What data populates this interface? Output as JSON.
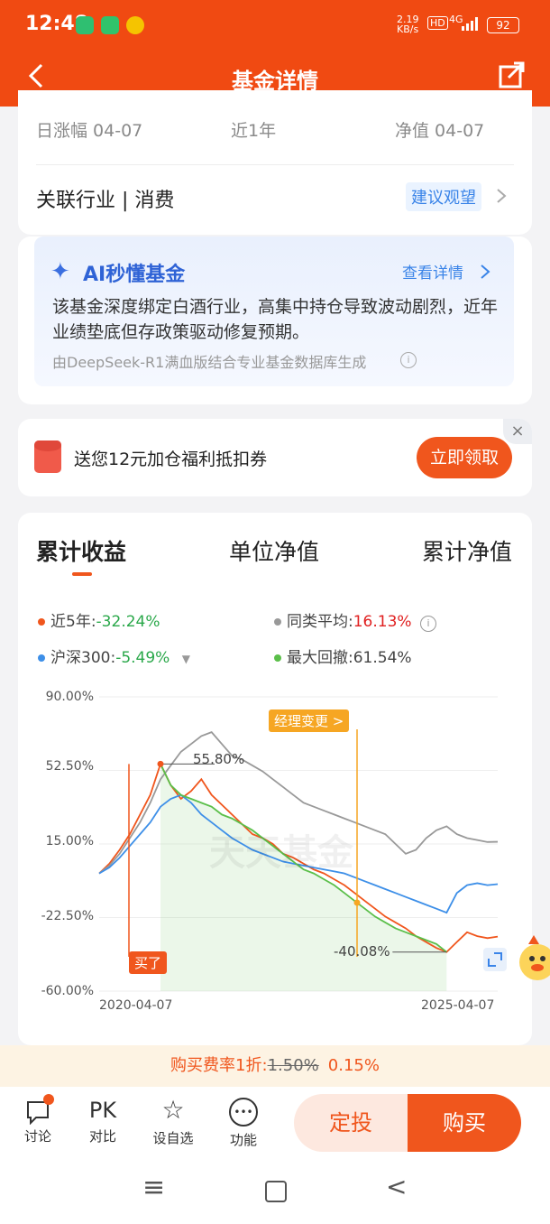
{
  "status": {
    "time": "12:48",
    "speed": "2.19\nKB/s",
    "hd": "HD",
    "network": "4G",
    "battery": "92"
  },
  "header": {
    "title": "基金详情"
  },
  "summary": {
    "labels": [
      "日涨幅 04-07",
      "近1年",
      "净值 04-07"
    ],
    "industry_label": "关联行业 | 消费",
    "advice": "建议观望"
  },
  "ai": {
    "title": "AI秒懂基金",
    "link": "查看详情",
    "text": "该基金深度绑定白酒行业，高集中持仓导致波动剧烈，近年业绩垫底但存政策驱动修复预期。",
    "source": "由DeepSeek-R1满血版结合专业基金数据库生成"
  },
  "coupon": {
    "text": "送您12元加仓福利抵扣券",
    "button": "立即领取",
    "close": "×"
  },
  "chart_tabs": [
    "累计收益",
    "单位净值",
    "累计净值"
  ],
  "legend": {
    "items": [
      {
        "label": "近5年:",
        "value": "-32.24%",
        "color": "#f0561d",
        "value_color": "#2aa84a"
      },
      {
        "label": "同类平均:",
        "value": "16.13%",
        "color": "#999999",
        "value_color": "#e02020"
      },
      {
        "label": "沪深300:",
        "value": "-5.49%",
        "color": "#3d8fe8",
        "value_color": "#2aa84a"
      },
      {
        "label": "最大回撤:",
        "value": "61.54%",
        "color": "#5bbf4a",
        "value_color": "#333333"
      }
    ]
  },
  "chart_data": {
    "type": "line",
    "x_start": "2020-04-07",
    "x_end": "2025-04-07",
    "yticks": [
      "90.00%",
      "52.50%",
      "15.00%",
      "-22.50%",
      "-60.00%"
    ],
    "ylim": [
      -60,
      90
    ],
    "annotations": {
      "peak": "55.80%",
      "trough": "-40.08%",
      "manager_change": "经理变更 >",
      "buy": "买了"
    },
    "watermark": "天天基金",
    "series": [
      {
        "name": "近5年",
        "color": "#f0561d",
        "values": [
          0,
          5,
          12,
          20,
          30,
          40,
          55.8,
          45,
          38,
          42,
          48,
          40,
          35,
          30,
          25,
          20,
          18,
          15,
          10,
          8,
          5,
          2,
          0,
          -3,
          -6,
          -10,
          -14,
          -18,
          -22,
          -25,
          -28,
          -32,
          -35,
          -38,
          -40.08,
          -35,
          -30,
          -32,
          -33,
          -32.24
        ]
      },
      {
        "name": "同类平均",
        "color": "#999999",
        "values": [
          0,
          4,
          10,
          18,
          26,
          36,
          48,
          55,
          62,
          66,
          70,
          72,
          66,
          60,
          58,
          55,
          52,
          48,
          44,
          40,
          36,
          34,
          32,
          30,
          28,
          26,
          24,
          22,
          20,
          15,
          10,
          12,
          18,
          22,
          24,
          20,
          18,
          17,
          16,
          16.13
        ]
      },
      {
        "name": "沪深300",
        "color": "#3d8fe8",
        "values": [
          0,
          3,
          8,
          14,
          20,
          26,
          34,
          38,
          40,
          36,
          30,
          26,
          22,
          18,
          15,
          12,
          10,
          8,
          6,
          5,
          4,
          3,
          2,
          1,
          0,
          -2,
          -4,
          -6,
          -8,
          -10,
          -12,
          -14,
          -16,
          -18,
          -20,
          -10,
          -6,
          -5,
          -6,
          -5.49
        ]
      },
      {
        "name": "最大回撤区间",
        "color": "#5bbf4a",
        "values": [
          null,
          null,
          null,
          null,
          null,
          null,
          55.8,
          45,
          40,
          38,
          36,
          34,
          30,
          28,
          25,
          22,
          18,
          14,
          10,
          6,
          2,
          0,
          -3,
          -6,
          -10,
          -14,
          -18,
          -22,
          -25,
          -28,
          -30,
          -32,
          -34,
          -36,
          -40.08,
          null,
          null,
          null,
          null,
          null
        ]
      }
    ]
  },
  "fee": {
    "label": "购买费率1折:",
    "old": "1.50%",
    "new": "0.15%"
  },
  "bottom": {
    "items": [
      {
        "label": "讨论",
        "icon": "讨"
      },
      {
        "label": "对比",
        "icon": "PK"
      },
      {
        "label": "设自选",
        "icon": "☆"
      },
      {
        "label": "功能",
        "icon": "•••"
      }
    ],
    "dingtou": "定投",
    "buy": "购买"
  },
  "system_nav": {
    "menu": "≡",
    "home": "□",
    "back": "<"
  }
}
